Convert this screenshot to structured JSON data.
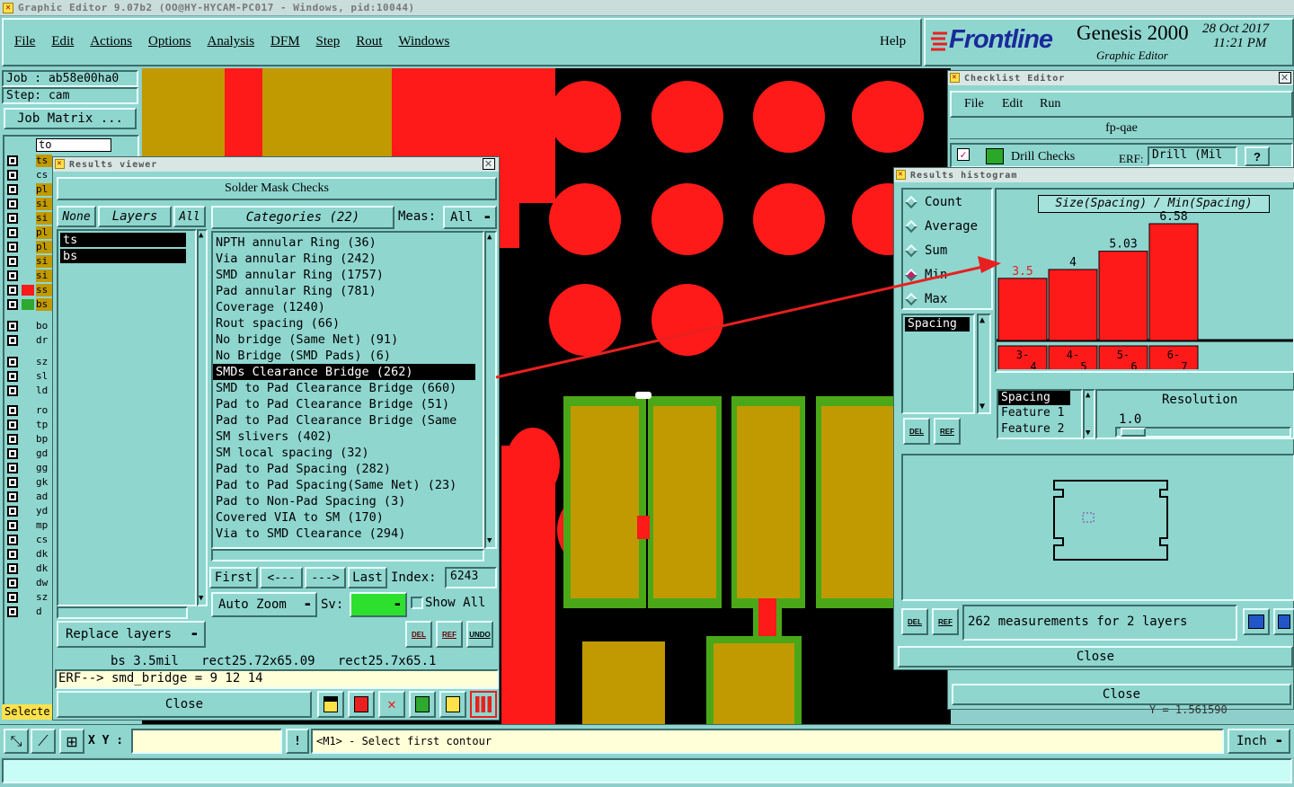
{
  "app": {
    "title": "Graphic Editor 9.07b2 (OO@HY-HYCAM-PC017 - Windows, pid:10044)",
    "menu": [
      "File",
      "Edit",
      "Actions",
      "Options",
      "Analysis",
      "DFM",
      "Step",
      "Rout",
      "Windows"
    ],
    "help": "Help",
    "brand": "Frontline",
    "product": "Genesis 2000",
    "subtitle": "Graphic Editor",
    "date": "28 Oct 2017",
    "time": "11:21 PM"
  },
  "left": {
    "job": "Job : ab58e00ha0",
    "step": "Step: cam",
    "job_matrix": "Job Matrix ...",
    "layer_input": "to",
    "layers": [
      "ts",
      "cs",
      "pl",
      "si",
      "si",
      "pl",
      "pl",
      "si",
      "si",
      "ss",
      "bs",
      "bo",
      "dr",
      "sz",
      "sl",
      "ld",
      "ro",
      "tp",
      "bp",
      "gd",
      "gg",
      "gk",
      "ad",
      "yd",
      "mp",
      "cs",
      "dk",
      "dk",
      "dw",
      "sz",
      "d"
    ],
    "selected": "Selecte"
  },
  "results_viewer": {
    "title": "Results viewer",
    "header": "Solder Mask Checks",
    "none_btn": "None",
    "layers_btn": "Layers",
    "all_btn": "All",
    "layer_list": [
      "ts",
      "bs"
    ],
    "categories_btn": "Categories (22)",
    "meas_label": "Meas:",
    "meas_value": "All",
    "categories": [
      "NPTH annular Ring (36)",
      "Via annular Ring (242)",
      "SMD annular Ring (1757)",
      "Pad annular Ring (781)",
      "Coverage (1240)",
      "Rout spacing (66)",
      "No bridge (Same Net) (91)",
      "No Bridge (SMD Pads) (6)",
      "SMDs Clearance Bridge (262)",
      "SMD to Pad Clearance Bridge (660)",
      "Pad to Pad Clearance Bridge (51)",
      "Pad to Pad Clearance Bridge (Same",
      "SM slivers (402)",
      "SM local spacing (32)",
      "Pad to Pad Spacing (282)",
      "Pad to Pad Spacing(Same Net) (23)",
      "Pad to Non-Pad Spacing (3)",
      "Covered VIA to SM (170)",
      "Via to SMD Clearance (294)"
    ],
    "selected_index": 8,
    "first": "First",
    "prev": "<---",
    "next": "--->",
    "last": "Last",
    "index_label": "Index:",
    "index_value": "6243",
    "auto_zoom": "Auto Zoom",
    "sv_label": "Sv:",
    "show_all": "Show All",
    "replace_layers": "Replace layers",
    "del": "DEL",
    "ref": "REF",
    "undo": "UNDO",
    "status_line": "bs 3.5mil   rect25.72x65.09   rect25.7x65.1",
    "erf_line": "ERF--> smd_bridge = 9 12 14",
    "close": "Close"
  },
  "checklist": {
    "title": "Checklist Editor",
    "menu": [
      "File",
      "Edit",
      "Run"
    ],
    "name": "fp-qae",
    "item": "Drill Checks",
    "erf_label": "ERF:",
    "erf_value": "Drill (Mil",
    "help_q": "?",
    "coord": "Y = 1.561590",
    "close": "Close"
  },
  "histogram": {
    "title": "Results histogram",
    "modes": [
      "Count",
      "Average",
      "Sum",
      "Min",
      "Max"
    ],
    "selected_mode": "Min",
    "list_left": [
      "Spacing"
    ],
    "chart_title": "Size(Spacing) / Min(Spacing)",
    "chart_data": {
      "type": "bar",
      "title": "Size(Spacing) / Min(Spacing)",
      "categories": [
        "3-4",
        "4-5",
        "5-6",
        "6-7"
      ],
      "cat_top": [
        "3-",
        "4-",
        "5-",
        "6-"
      ],
      "cat_bottom": [
        "4",
        "5",
        "6",
        "7"
      ],
      "values": [
        3.5,
        4,
        5.03,
        6.58
      ],
      "labels": [
        "3.5",
        "4",
        "5.03",
        "6.58"
      ],
      "bar_color": "#ff1a1a",
      "first_label_color": "#e02020"
    },
    "attr_list": [
      "Spacing",
      "Feature 1",
      "Feature 2"
    ],
    "resolution_label": "Resolution",
    "resolution_value": "1.0",
    "measurements": "262 measurements for 2 layers",
    "del": "DEL",
    "ref": "REF",
    "close": "Close"
  },
  "bottom": {
    "xy_label": "X Y :",
    "xy_value": "",
    "excl": "!",
    "message": "<M1> - Select first contour",
    "unit": "Inch"
  }
}
